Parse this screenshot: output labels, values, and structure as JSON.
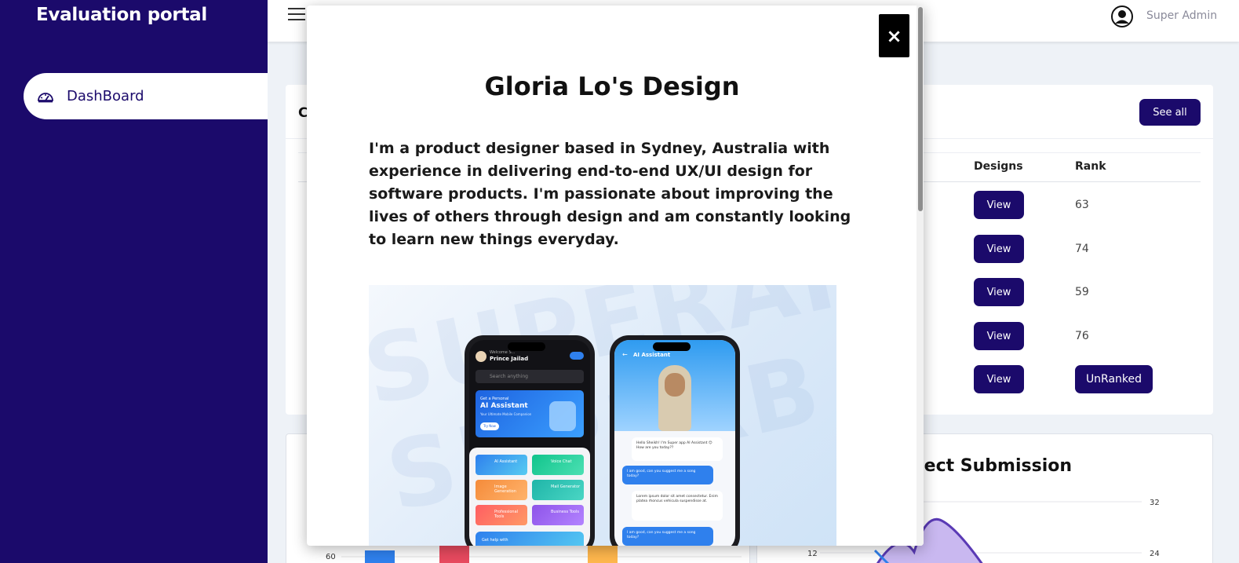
{
  "sidebar": {
    "brand": "Evaluation portal",
    "items": [
      {
        "label": "DashBoard",
        "icon": "dashboard-icon"
      }
    ]
  },
  "topbar": {
    "user_name": "Super Admin"
  },
  "dashboard": {
    "partial_title": "C",
    "see_all_label": "See all",
    "columns": {
      "designs": "Designs",
      "rank": "Rank"
    },
    "rows": [
      {
        "view": "View",
        "rank": "63"
      },
      {
        "view": "View",
        "rank": "74"
      },
      {
        "view": "View",
        "rank": "59"
      },
      {
        "view": "View",
        "rank": "76"
      },
      {
        "view": "View",
        "rank": "UnRanked"
      }
    ],
    "left_chart_tick": "60",
    "right_chart_title": "oject Submission",
    "right_chart_ticks": {
      "left": "12",
      "right_top": "32",
      "right_bottom": "24"
    }
  },
  "modal": {
    "close_label": "×",
    "title": "Gloria Lo's Design",
    "description": "I'm a product designer based in Sydney, Australia with experience in delivering end-to-end UX/UI design for software products. I'm passionate about improving the lives of others through design and am constantly looking to learn new things everyday.",
    "showcase": {
      "phone1": {
        "welcome": "Welcome S...",
        "user": "Prince Jailad",
        "search_placeholder": "Search anything",
        "promo_small": "Get a Personal",
        "promo_big": "AI Assistant",
        "promo_sub": "Your Ultimate Mobile Companion",
        "promo_btn": "Try Now",
        "tiles": [
          "AI Assistant",
          "Voice Chat",
          "Image Generation",
          "Mail Generator",
          "Professional Tools",
          "Business Tools"
        ],
        "bottom": "Get help with"
      },
      "phone2": {
        "header": "AI Assistant",
        "messages": [
          "Hello Sheikh! I'm Super app AI Assistant 😊 How are you today??",
          "I am good, can you suggest me a song today?",
          "Lorem ipsum dolor sit amet consectetur. Enim platea rhoncus vehicula suspendisse at.",
          "I am good, can you suggest me a song today?"
        ]
      }
    }
  }
}
